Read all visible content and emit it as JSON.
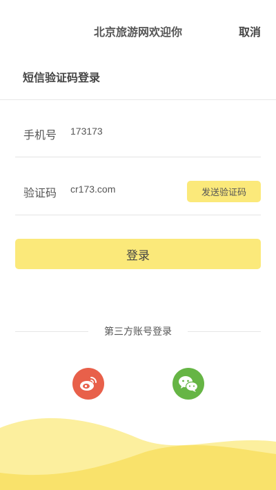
{
  "header": {
    "title": "北京旅游网欢迎你",
    "cancel_label": "取消"
  },
  "login": {
    "section_title": "短信验证码登录",
    "phone": {
      "label": "手机号",
      "value": "173173"
    },
    "code": {
      "label": "验证码",
      "value": "cr173.com",
      "send_label": "发送验证码"
    },
    "submit_label": "登录"
  },
  "third_party": {
    "label": "第三方账号登录",
    "icons": [
      "weibo-icon",
      "wechat-icon"
    ]
  },
  "colors": {
    "accent_yellow": "#fbe97a",
    "weibo_red": "#e8604a",
    "wechat_green": "#66b545",
    "wave_light": "#fcef9e",
    "wave_dark": "#f9e26b"
  }
}
